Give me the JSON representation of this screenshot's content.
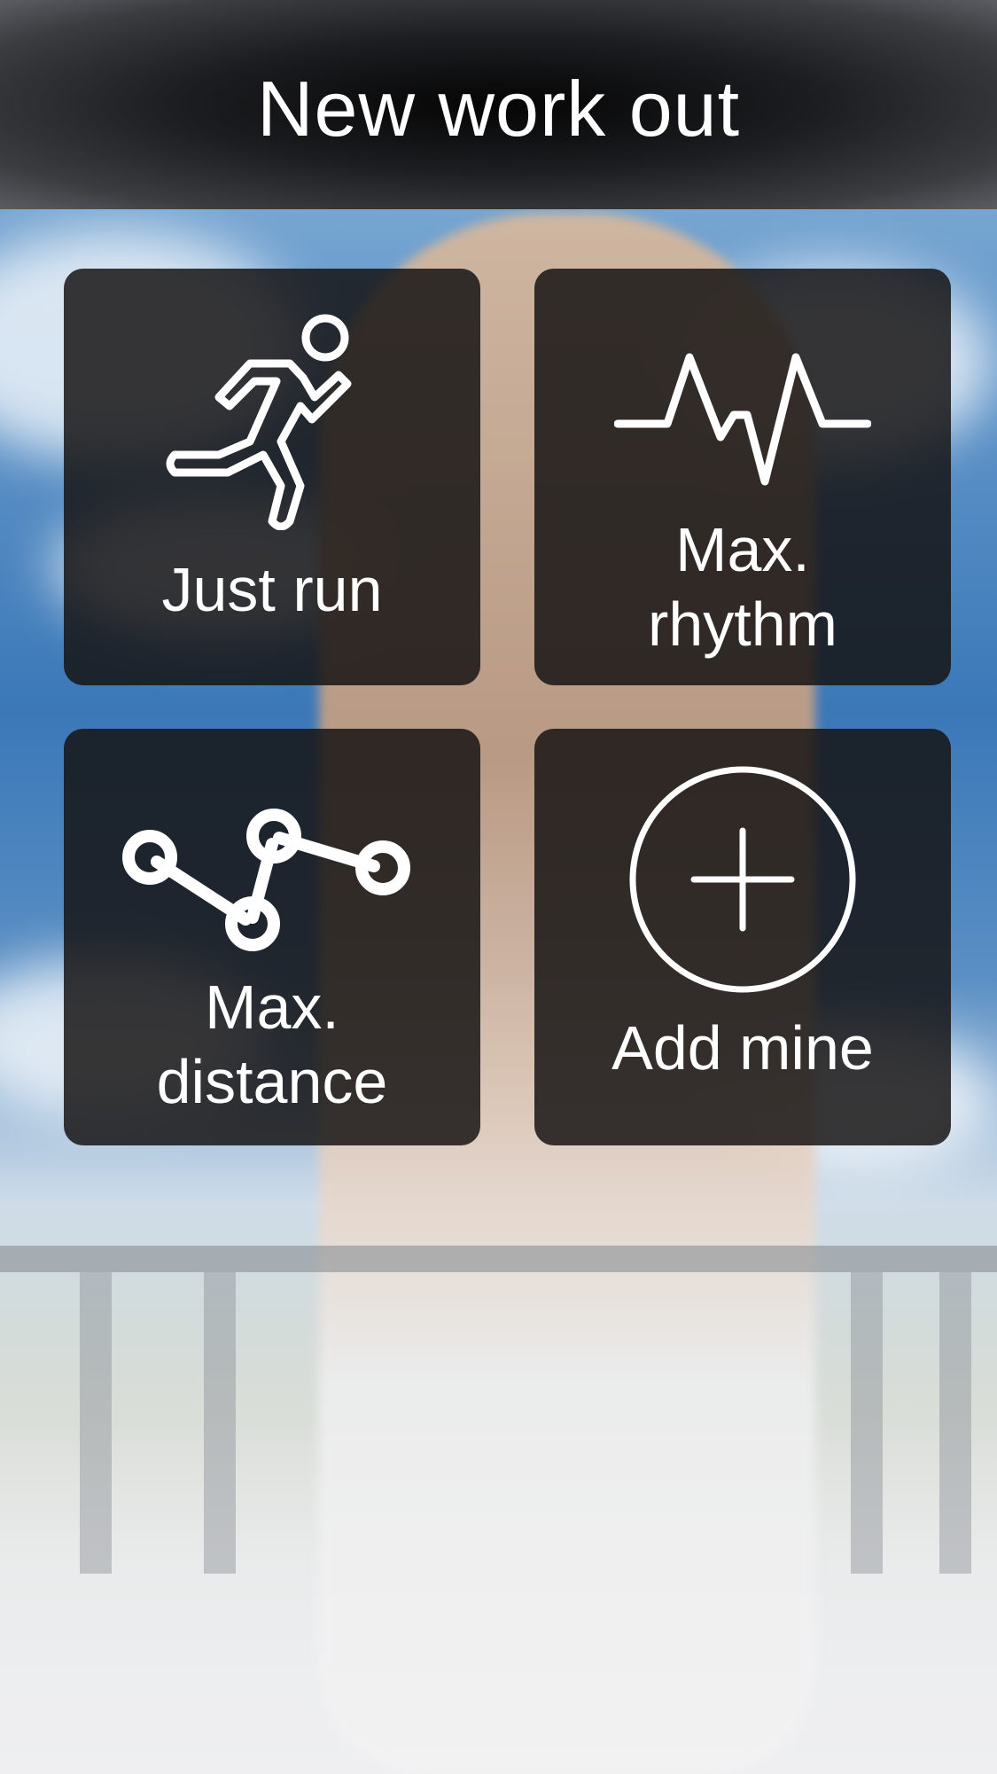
{
  "header": {
    "title": "New work out"
  },
  "tiles": [
    {
      "label_line1": "Just run",
      "label_line2": "",
      "icon": "runner-icon"
    },
    {
      "label_line1": "Max.",
      "label_line2": "rhythm",
      "icon": "heartbeat-icon"
    },
    {
      "label_line1": "Max.",
      "label_line2": "distance",
      "icon": "route-icon"
    },
    {
      "label_line1": "Add mine",
      "label_line2": "",
      "icon": "add-circle-icon"
    }
  ],
  "colors": {
    "tile_background": "#141212",
    "icon_color": "#ffffff",
    "header_background": "#1c1d20"
  }
}
